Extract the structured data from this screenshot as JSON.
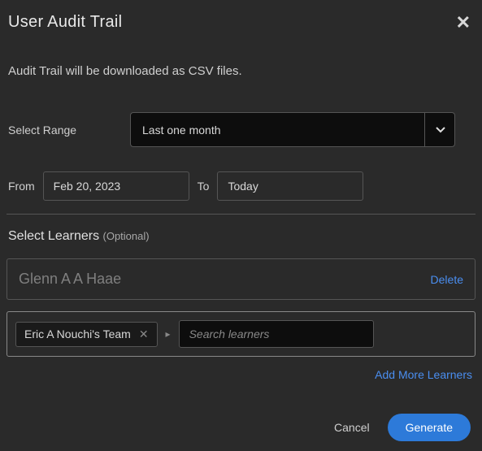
{
  "header": {
    "title": "User Audit Trail"
  },
  "description": "Audit Trail will be downloaded as CSV files.",
  "range": {
    "label": "Select Range",
    "value": "Last one month"
  },
  "dates": {
    "from_label": "From",
    "from_value": "Feb 20, 2023",
    "to_label": "To",
    "to_value": "Today"
  },
  "learners_section": {
    "title": "Select Learners ",
    "optional": "(Optional)"
  },
  "learner1": {
    "name": "Glenn A A Haae",
    "delete": "Delete"
  },
  "learner2": {
    "chip": "Eric A Nouchi's Team",
    "search_placeholder": "Search learners"
  },
  "add_more": "Add More Learners",
  "footer": {
    "cancel": "Cancel",
    "generate": "Generate"
  }
}
